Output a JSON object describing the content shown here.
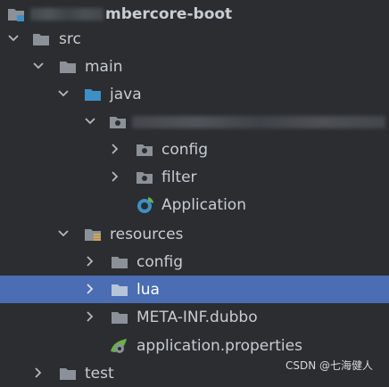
{
  "tree": {
    "root": {
      "label": "mbercore-boot"
    },
    "src": {
      "label": "src"
    },
    "main": {
      "label": "main"
    },
    "java": {
      "label": "java"
    },
    "package": {
      "label": ""
    },
    "config_pkg": {
      "label": "config"
    },
    "filter_pkg": {
      "label": "filter"
    },
    "application_class": {
      "label": "Application"
    },
    "resources": {
      "label": "resources"
    },
    "config_res": {
      "label": "config"
    },
    "lua": {
      "label": "lua"
    },
    "meta_inf": {
      "label": "META-INF.dubbo"
    },
    "app_props": {
      "label": "application.properties"
    },
    "test": {
      "label": "test"
    }
  },
  "watermark": {
    "text": "CSDN @七海健人"
  },
  "colors": {
    "background": "#2b2d30",
    "selection": "#4a6db3",
    "folder": "#8c9199",
    "java_folder": "#3d8fc6"
  }
}
